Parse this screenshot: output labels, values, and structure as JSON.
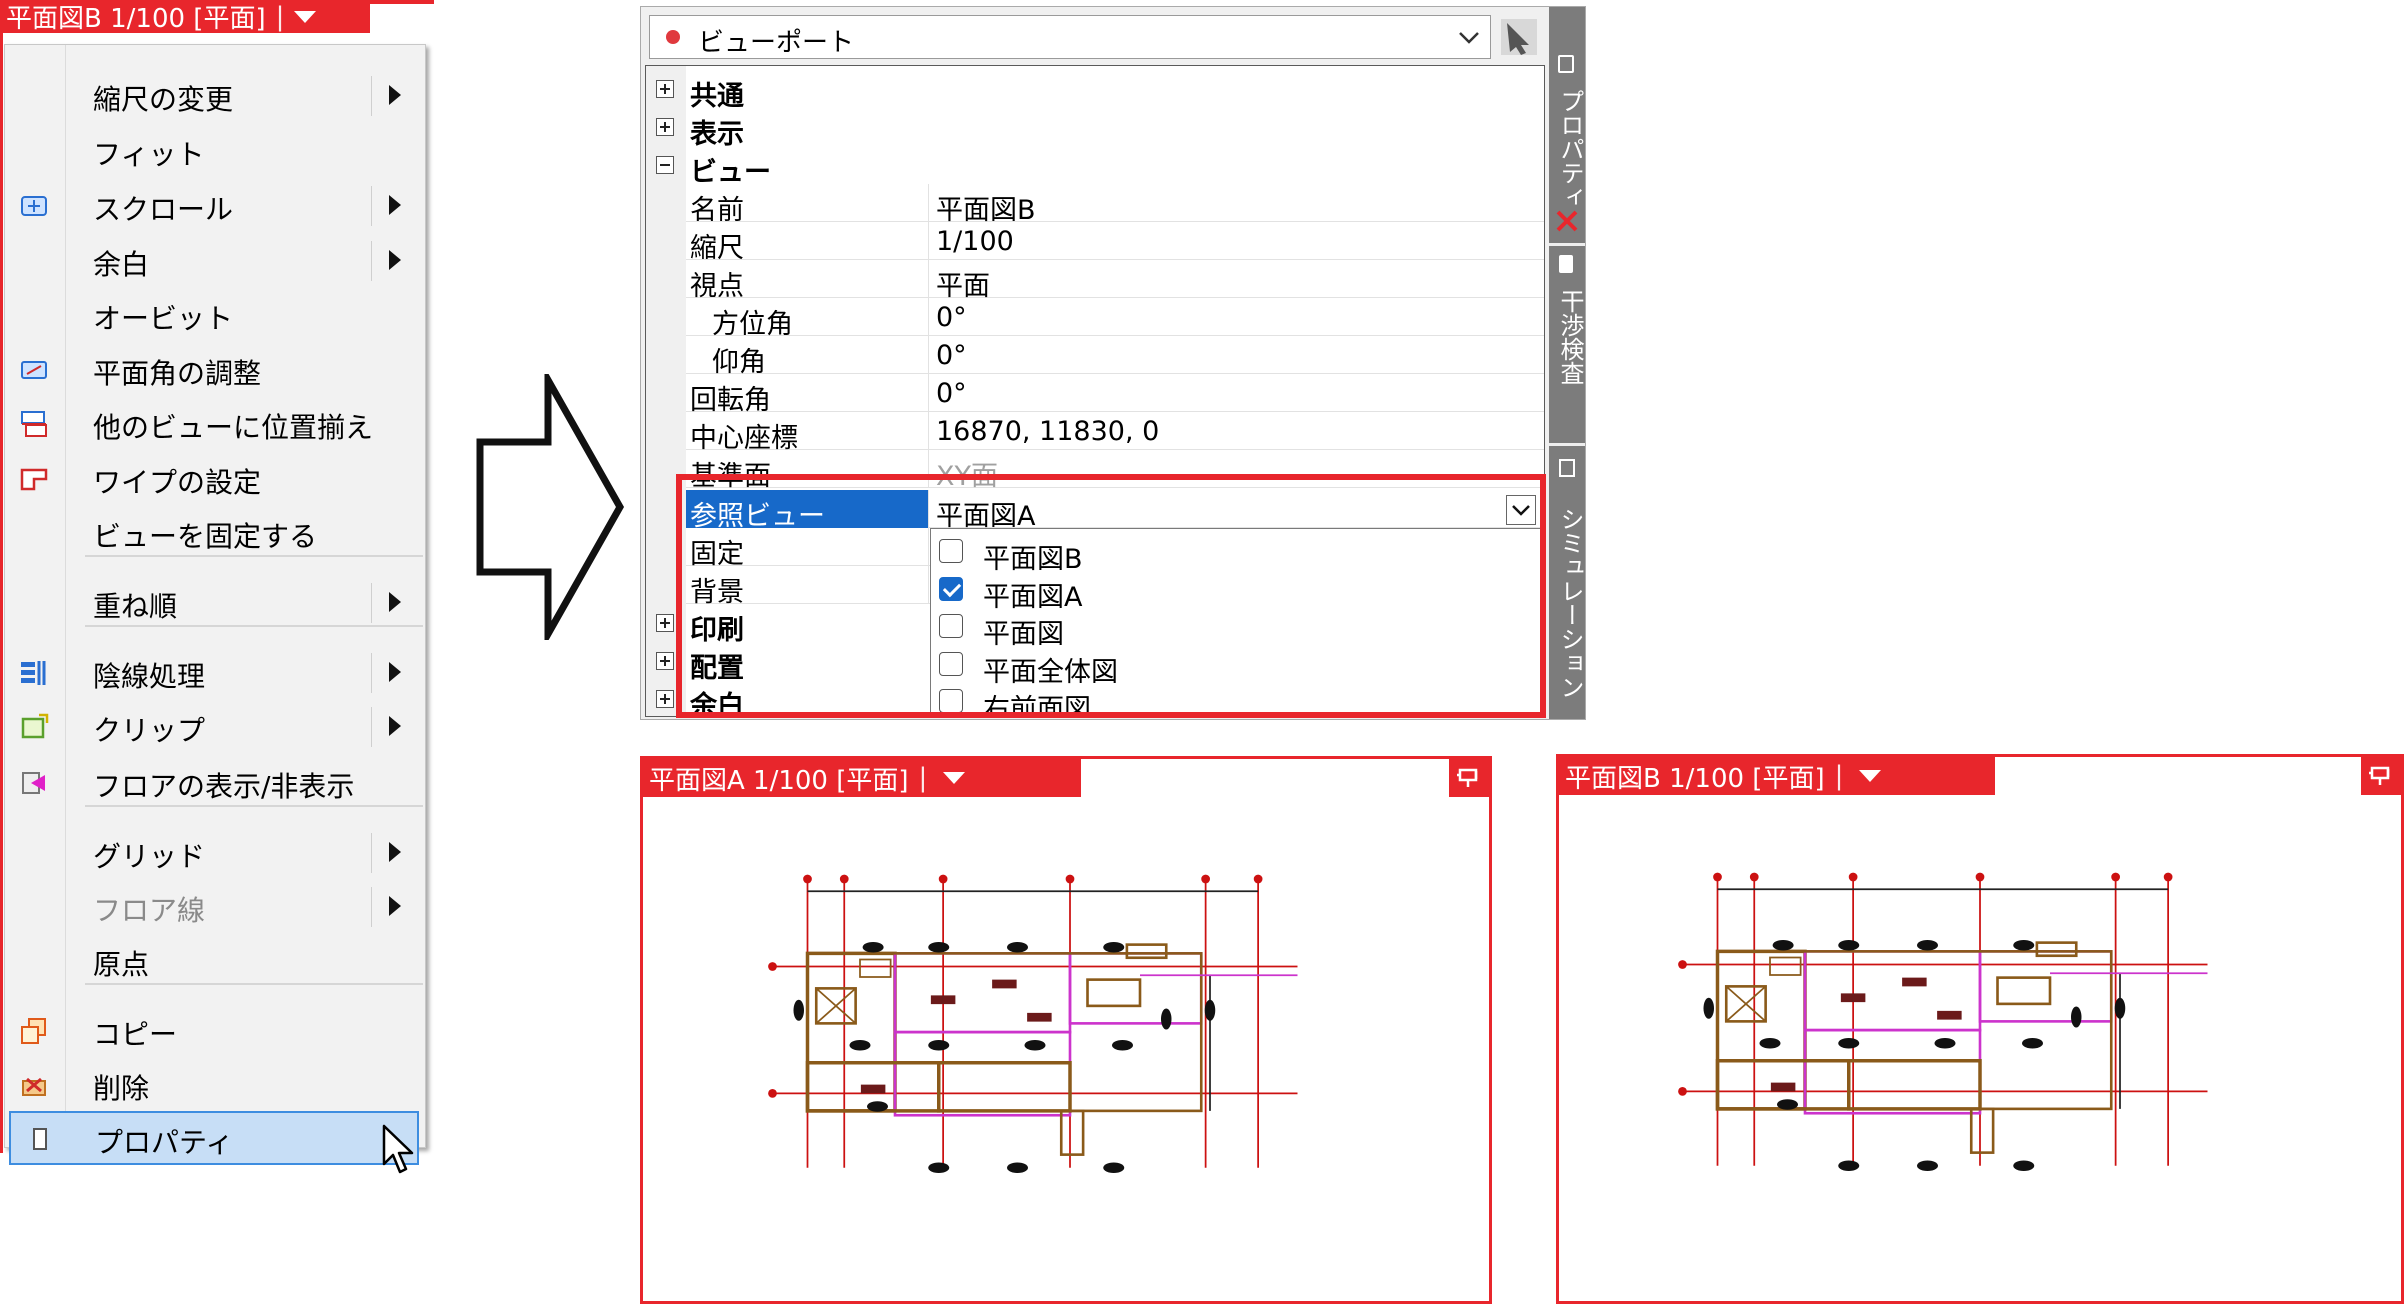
{
  "menu": {
    "tab": {
      "title": "平面図B 1/100 [平面]",
      "sep": "|"
    },
    "items": [
      {
        "label": "縮尺の変更",
        "submenu": true,
        "icon": null
      },
      {
        "label": "フィット",
        "submenu": false,
        "icon": null
      },
      {
        "label": "スクロール",
        "submenu": true,
        "icon": "scroll-icon"
      },
      {
        "label": "余白",
        "submenu": true,
        "icon": null
      },
      {
        "label": "オービット",
        "submenu": false,
        "icon": null
      },
      {
        "label": "平面角の調整",
        "submenu": false,
        "icon": "plane-angle-icon"
      },
      {
        "label": "他のビューに位置揃え",
        "submenu": false,
        "icon": "align-views-icon"
      },
      {
        "label": "ワイプの設定",
        "submenu": false,
        "icon": "wipe-icon"
      },
      {
        "label": "ビューを固定する",
        "submenu": false,
        "icon": null
      },
      {
        "label": "重ね順",
        "submenu": true,
        "icon": null
      },
      {
        "label": "陰線処理",
        "submenu": true,
        "icon": "hidden-line-icon"
      },
      {
        "label": "クリップ",
        "submenu": true,
        "icon": "clip-icon"
      },
      {
        "label": "フロアの表示/非表示",
        "submenu": false,
        "icon": "floor-visibility-icon"
      },
      {
        "label": "グリッド",
        "submenu": true,
        "icon": null
      },
      {
        "label": "フロア線",
        "submenu": true,
        "icon": null,
        "disabled": true
      },
      {
        "label": "原点",
        "submenu": false,
        "icon": null
      },
      {
        "label": "コピー",
        "submenu": false,
        "icon": "copy-icon"
      },
      {
        "label": "削除",
        "submenu": false,
        "icon": "delete-icon"
      },
      {
        "label": "プロパティ",
        "submenu": false,
        "icon": "properties-icon",
        "highlighted": true
      }
    ]
  },
  "properties": {
    "combo": {
      "label": "ビューポート"
    },
    "side_tabs": [
      "プロパティ",
      "干渉検査",
      "シミュレーション"
    ],
    "rows": [
      {
        "key": "共通",
        "value": "",
        "category": true,
        "expanded": false
      },
      {
        "key": "表示",
        "value": "",
        "category": true,
        "expanded": false
      },
      {
        "key": "ビュー",
        "value": "",
        "category": true,
        "expanded": true
      },
      {
        "key": "名前",
        "value": "平面図B"
      },
      {
        "key": "縮尺",
        "value": "1/100"
      },
      {
        "key": "視点",
        "value": "平面"
      },
      {
        "key": "方位角",
        "value": "0°",
        "indent": true
      },
      {
        "key": "仰角",
        "value": "0°",
        "indent": true
      },
      {
        "key": "回転角",
        "value": "0°"
      },
      {
        "key": "中心座標",
        "value": "16870, 11830, 0"
      },
      {
        "key": "基準面",
        "value": "XY面",
        "dim": true
      },
      {
        "key": "参照ビュー",
        "value": "平面図A",
        "selected": true
      },
      {
        "key": "固定",
        "value": ""
      },
      {
        "key": "背景",
        "value": ""
      },
      {
        "key": "印刷",
        "value": "",
        "category": true,
        "expanded": false
      },
      {
        "key": "配置",
        "value": "",
        "category": true,
        "expanded": false
      },
      {
        "key": "余白",
        "value": "",
        "category": true,
        "expanded": false
      }
    ],
    "dropdown": [
      {
        "label": "平面図B",
        "checked": false
      },
      {
        "label": "平面図A",
        "checked": true
      },
      {
        "label": "平面図",
        "checked": false
      },
      {
        "label": "平面全体図",
        "checked": false
      },
      {
        "label": "右前面図",
        "checked": false
      }
    ]
  },
  "views": [
    {
      "title": "平面図A 1/100 [平面]",
      "sep": "|"
    },
    {
      "title": "平面図B 1/100 [平面]",
      "sep": "|"
    }
  ],
  "colors": {
    "accent_red": "#e8262c",
    "selection_blue": "#1769c9",
    "plan_brown": "#8a5a1a",
    "plan_magenta": "#cc33cc",
    "plan_red": "#cc1111"
  }
}
